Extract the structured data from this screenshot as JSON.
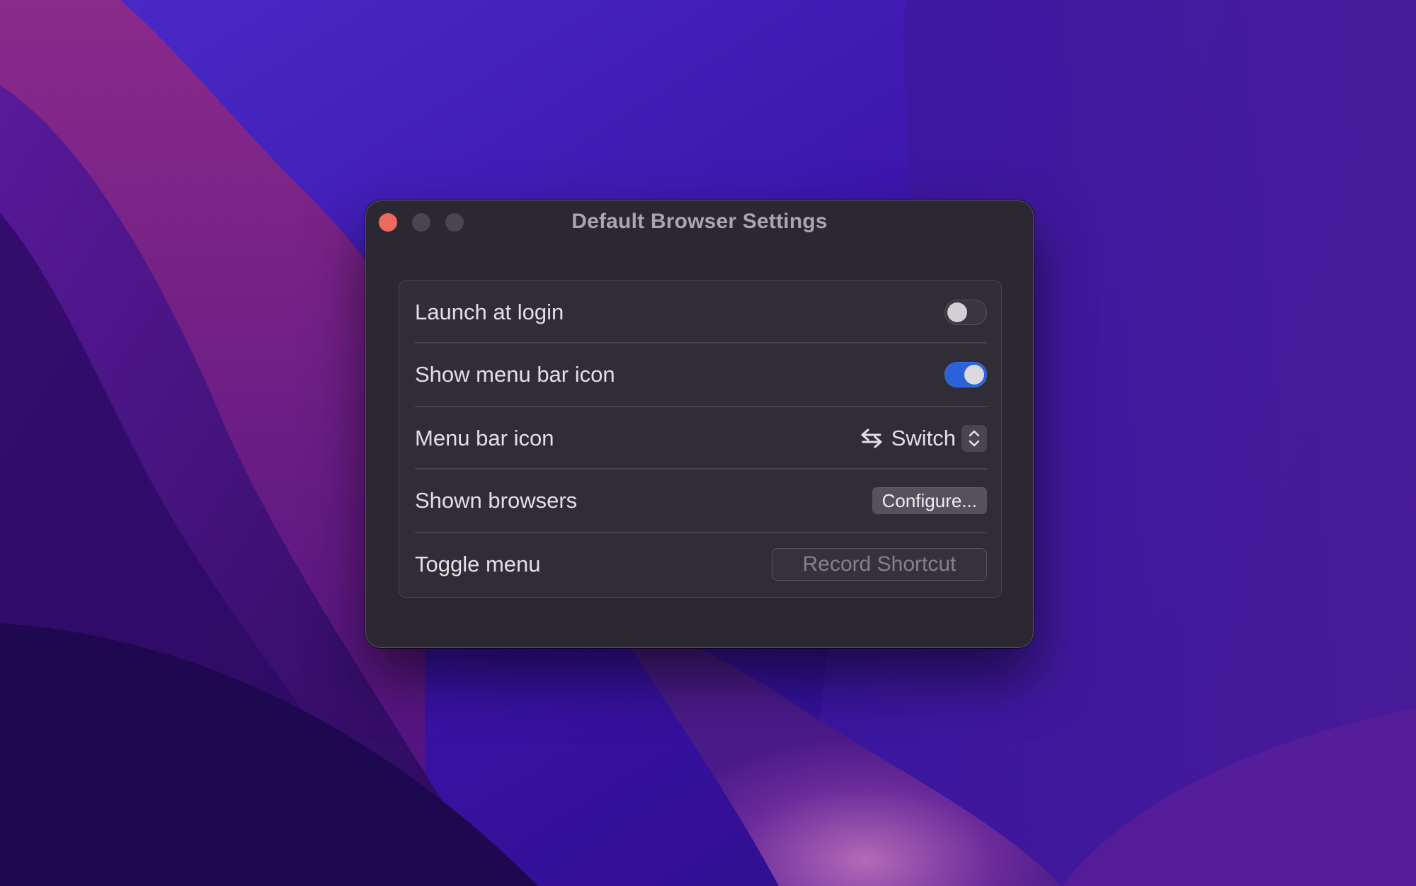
{
  "window": {
    "title": "Default Browser Settings"
  },
  "settings": {
    "launch_at_login": {
      "label": "Launch at login",
      "enabled": false
    },
    "show_menu_bar_icon": {
      "label": "Show menu bar icon",
      "enabled": true
    },
    "menu_bar_icon": {
      "label": "Menu bar icon",
      "selected": "Switch",
      "icon": "arrows-left-right-icon"
    },
    "shown_browsers": {
      "label": "Shown browsers",
      "button_label": "Configure..."
    },
    "toggle_menu": {
      "label": "Toggle menu",
      "shortcut_placeholder": "Record Shortcut"
    }
  },
  "colors": {
    "accent": "#2c62d8",
    "close_button": "#ee6a5e",
    "window_bg": "#2c2831"
  }
}
